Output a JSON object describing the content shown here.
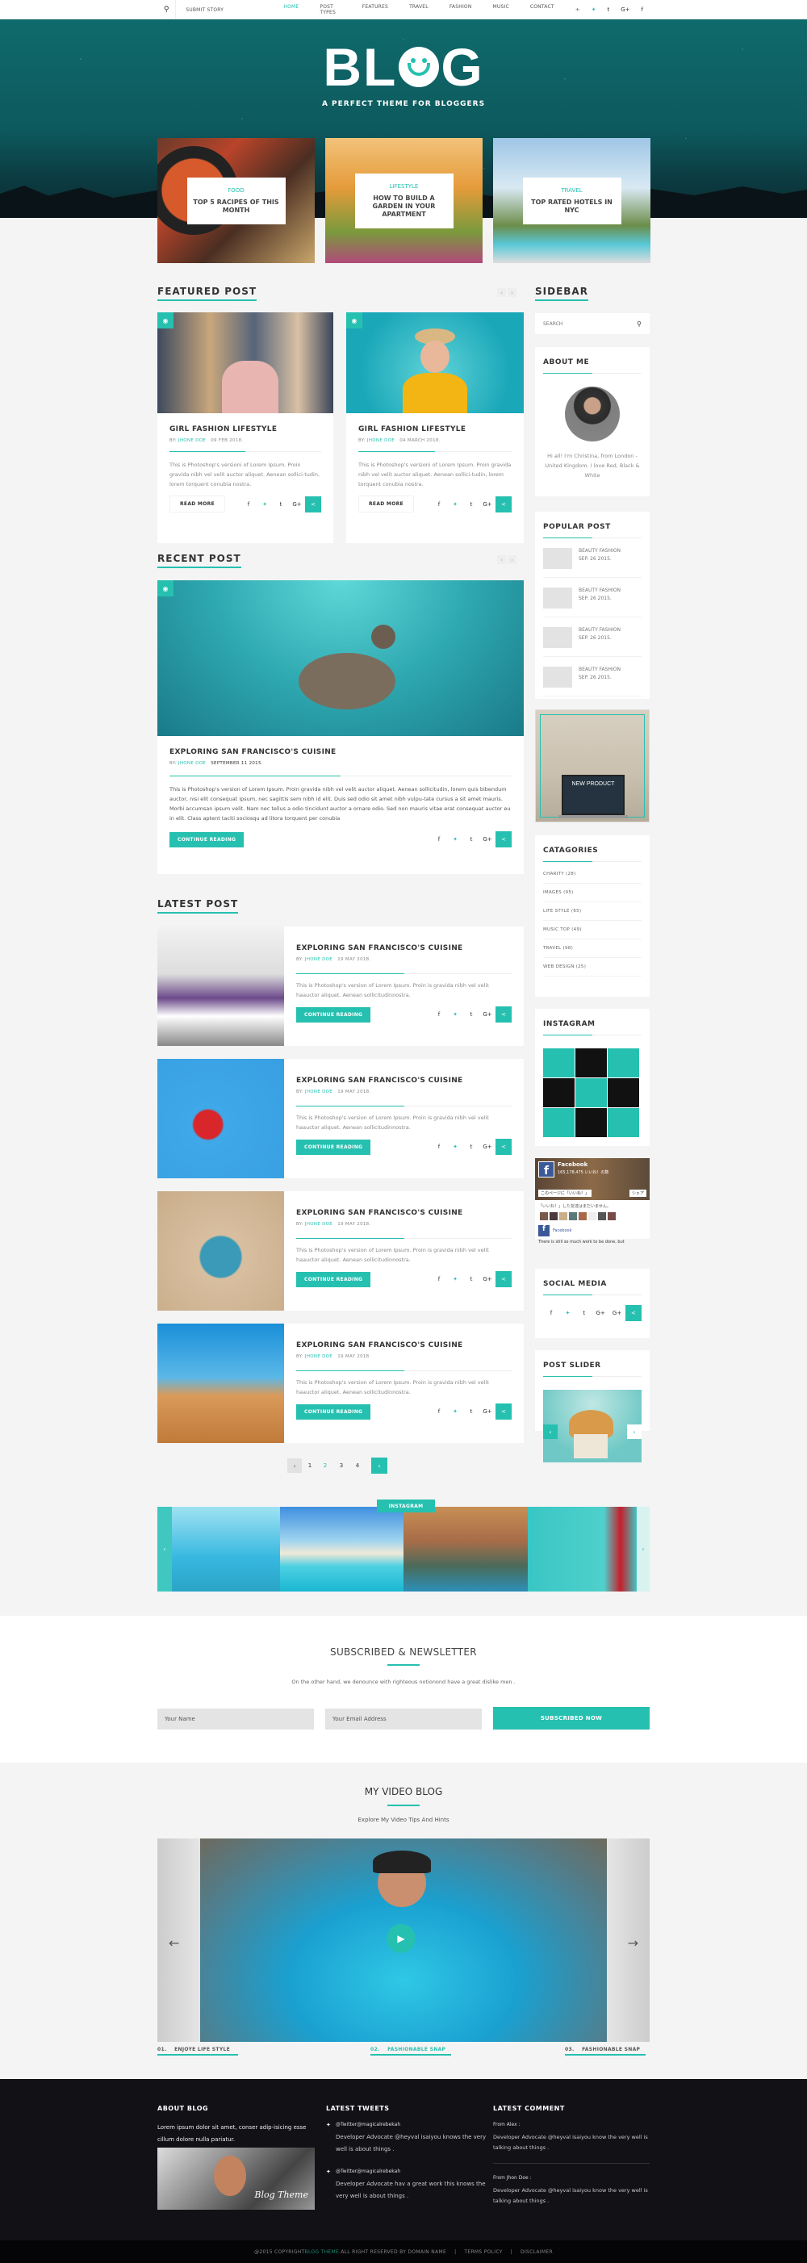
{
  "nav": {
    "submit_story": "SUBMIT STORY",
    "menu": [
      "HOME",
      "POST TYPES",
      "FEATURES",
      "TRAVEL",
      "FASHION",
      "MUSIC",
      "CONTACT"
    ],
    "active_index": 0,
    "social_icons": [
      "rss-icon",
      "twitter-icon",
      "tumblr-icon",
      "google-plus-icon",
      "facebook-icon"
    ]
  },
  "hero": {
    "logo_left": "BL",
    "logo_right": "G",
    "tagline": "A PERFECT THEME FOR BLOGGERS",
    "slides": [
      {
        "category": "FOOD",
        "title": "TOP 5 RACIPES OF THIS MONTH"
      },
      {
        "category": "LIFESTYLE",
        "title": "HOW TO BUILD A GARDEN IN YOUR APARTMENT"
      },
      {
        "category": "TRAVEL",
        "title": "TOP RATED HOTELS IN NYC"
      }
    ]
  },
  "featured": {
    "title": "FEATURED POST",
    "posts": [
      {
        "title": "GIRL FASHION LIFESTYLE",
        "by": "BY:",
        "author": "JHONE DOE",
        "date": "09 FEB 2018.",
        "excerpt": "This is Photoshop's versioni  of Lorem Ipsum. Proin gravida nibh vel velit auctor aliquet. Aenean sollici-tudin, lorem  torquent conubia nostra.",
        "button": "READ MORE"
      },
      {
        "title": "GIRL FASHION LIFESTYLE",
        "by": "BY:",
        "author": "JHONE DOE",
        "date": "04 MARCH 2018.",
        "excerpt": "This is Photoshop's versioni  of Lorem Ipsum. Proin gravida nibh vel velit auctor aliquet. Aenean sollici-tudin, lorem  torquent conubia nostra.",
        "button": "READ MORE"
      }
    ]
  },
  "recent": {
    "title": "RECENT POST",
    "post": {
      "title": "EXPLORING SAN FRANCISCO'S CUISINE",
      "by": "BY:",
      "author": "JHONE DOE",
      "date": "SEPTEMBER 11 2015.",
      "excerpt": "This is Photoshop's version  of Lorem Ipsum. Proin gravida nibh vel velit auctor aliquet. Aenean sollicitudin, lorem quis bibendum auctor, nisi elit consequat ipsum, nec sagittis sem nibh id elit. Duis sed odio sit amet nibh vulpu-tate cursus a sit amet mauris. Morbi accumsan ipsum velit. Nam nec tellus a odio tincidunt auctor a ornare odio. Sed non  mauris vitae erat consequat auctor eu in elit. Class aptent taciti sociosqu ad litora torquent per conubia",
      "button": "CONTINUE READING"
    }
  },
  "latest": {
    "title": "LATEST POST",
    "posts": [
      {
        "title": "EXPLORING SAN FRANCISCO'S CUISINE",
        "by": "BY:",
        "author": "JHONE DOE",
        "date": "19 MAY 2018.",
        "excerpt": "This is Photoshop's version  of Lorem Ipsum. Proin is gravida nibh vel velit haauctor aliquet. Aenean sollicitudinnostra.",
        "button": "CONTINUE READING"
      },
      {
        "title": "EXPLORING SAN FRANCISCO'S CUISINE",
        "by": "BY:",
        "author": "JHONE DOE",
        "date": "19 MAY 2018.",
        "excerpt": "This is Photoshop's version  of Lorem Ipsum. Proin is gravida nibh vel velit haauctor aliquet. Aenean sollicitudinnostra.",
        "button": "CONTINUE READING"
      },
      {
        "title": "EXPLORING SAN FRANCISCO'S CUISINE",
        "by": "BY:",
        "author": "JHONE DOE",
        "date": "19 MAY 2018.",
        "excerpt": "This is Photoshop's version  of Lorem Ipsum. Proin is gravida nibh vel velit haauctor aliquet. Aenean sollicitudinnostra.",
        "button": "CONTINUE READING"
      },
      {
        "title": "EXPLORING SAN FRANCISCO'S CUISINE",
        "by": "BY:",
        "author": "JHONE DOE",
        "date": "19 MAY 2018.",
        "excerpt": "This is Photoshop's version  of Lorem Ipsum. Proin is gravida nibh vel velit haauctor aliquet. Aenean sollicitudinnostra.",
        "button": "CONTINUE READING"
      }
    ],
    "pagination": {
      "prev": "‹",
      "pages": [
        "1",
        "2",
        "3",
        "4"
      ],
      "current": "2",
      "next": "›"
    }
  },
  "sidebar": {
    "title": "SIDEBAR",
    "search_placeholder": "SEARCH",
    "about": {
      "title": "ABOUT ME",
      "text": "Hi all! I'm Christina, from London - United Kingdom. I love Red, Black & White"
    },
    "popular": {
      "title": "POPULAR POST",
      "items": [
        {
          "title": "BEAUTY FASHION",
          "date": "SEP. 26 2015."
        },
        {
          "title": "BEAUTY FASHION",
          "date": "SEP. 26 2015."
        },
        {
          "title": "BEAUTY FASHION",
          "date": "SEP. 26 2015."
        },
        {
          "title": "BEAUTY FASHION",
          "date": "SEP. 26 2015."
        }
      ]
    },
    "ad_text": "NEW PRODUCT",
    "categories": {
      "title": "CATAGORIES",
      "items": [
        "CHARITY  (28)",
        "IMAGES  (95)",
        "LIFE STYLE  (65)",
        "MUSIC TOP  (49)",
        "TRAVEL  (98)",
        "WEB DESIGN  (25)"
      ]
    },
    "instagram": {
      "title": "INSTAGRAM",
      "colors": [
        "#26c0b0",
        "#111111",
        "#26c0b0",
        "#111111",
        "#26c0b0",
        "#111111",
        "#26c0b0",
        "#111111",
        "#26c0b0"
      ]
    },
    "facebook": {
      "name": "Facebook",
      "likes": "165,178,475 いいね！の数",
      "like_btn": "このページに「いいね！」",
      "share_btn": "シェア",
      "note": "「いいね！」した友達はまだいません。",
      "post_name": "Facebook",
      "post_text": "There is still so much work to be done, but"
    },
    "social": {
      "title": "SOCIAL MEDIA",
      "icons": [
        "f",
        "t",
        "t",
        "G+",
        "G+",
        "<"
      ]
    },
    "slider": {
      "title": "POST SLIDER"
    }
  },
  "instagram_strip": {
    "label": "INSTAGRAM"
  },
  "newsletter": {
    "title": "SUBSCRIBED & NEWSLETTER",
    "text": "On the other hand, we denounce with righteous notionond have a great dislike men .",
    "name_placeholder": "Your Name",
    "email_placeholder": "Your Email Address",
    "button": "SUBSCRIBED NOW"
  },
  "video": {
    "title": "MY VIDEO BLOG",
    "subtitle": "Explore My Video Tips And Hints",
    "items": [
      {
        "num": "01.",
        "label": "ENJOYE LIFE STYLE"
      },
      {
        "num": "02.",
        "label": "FASHIONABLE SNAP"
      },
      {
        "num": "03.",
        "label": "FASHIONABLE SNAP"
      }
    ]
  },
  "footer": {
    "about": {
      "title": "ABOUT BLOG",
      "text": "Lorem ipsum dolor sit amet, conser adip-isicing  esse cillum dolore nulla pariatur.",
      "img_text": "Blog Theme"
    },
    "tweets": {
      "title": "LATEST TWEETS",
      "items": [
        {
          "handle": "@Twitter@magicalrebekah",
          "text": "Developer Advocate @heyval isaiyou knows the very well is about things ."
        },
        {
          "handle": "@Twitter@magicalrebekah",
          "text": "Developer Advocate hav a great work this knows the very well is about things ."
        }
      ]
    },
    "comments": {
      "title": "LATEST COMMENT",
      "items": [
        {
          "from": "From Alex :",
          "text": "Developer Advocate @heyval isaiyou know the very well is talking about things ."
        },
        {
          "from": "From Jhon Doe :",
          "text": "Developer Advocate @heyval isaiyou know the very well is talking about things ."
        }
      ]
    },
    "copyright_pre": "@2015 COPYRIGHT ",
    "copyright_brand": "BLOG THEME",
    "copyright_post": " .ALL RIGHT RESERVED BY DOMAIN NAME",
    "terms": "TERMS POLICY",
    "disclaimer": "DISCLAIMER"
  }
}
